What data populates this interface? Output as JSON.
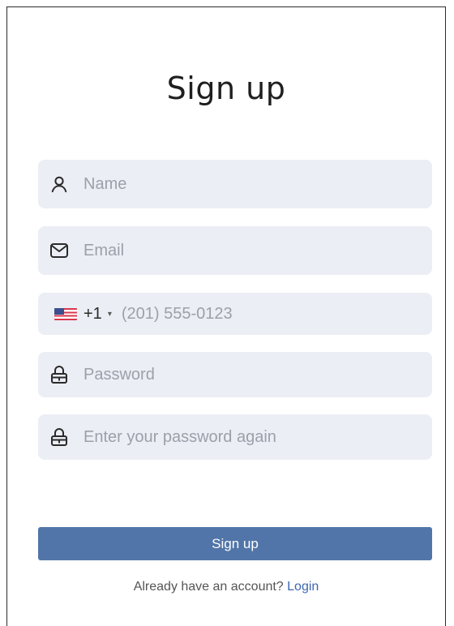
{
  "form": {
    "title": "Sign up",
    "fields": {
      "name": {
        "icon": "user-icon",
        "placeholder": "Name"
      },
      "email": {
        "icon": "envelope-icon",
        "placeholder": "Email"
      },
      "phone": {
        "country_flag": "us-flag-icon",
        "dial_code": "+1",
        "caret": "▾",
        "placeholder": "(201) 555-0123"
      },
      "password": {
        "icon": "lock-icon",
        "placeholder": "Password"
      },
      "confirm_password": {
        "icon": "lock-icon",
        "placeholder": "Enter your password again"
      }
    },
    "submit_label": "Sign up",
    "footer": {
      "prompt": "Already have an account?",
      "link_label": "Login"
    }
  },
  "colors": {
    "field_bg": "#eceef5",
    "button_bg": "#5175a8",
    "link": "#3d67b0"
  }
}
